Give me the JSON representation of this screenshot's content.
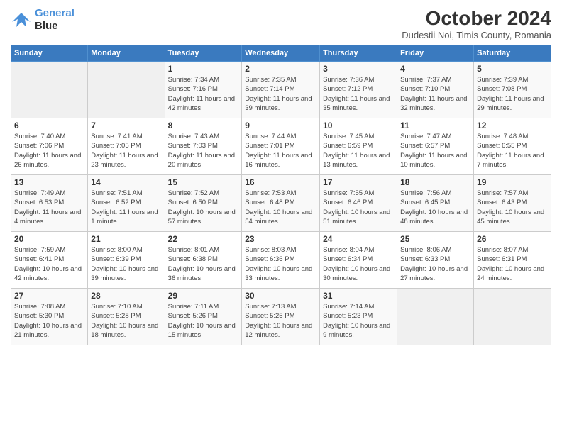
{
  "logo": {
    "line1": "General",
    "line2": "Blue"
  },
  "title": "October 2024",
  "subtitle": "Dudestii Noi, Timis County, Romania",
  "days_of_week": [
    "Sunday",
    "Monday",
    "Tuesday",
    "Wednesday",
    "Thursday",
    "Friday",
    "Saturday"
  ],
  "weeks": [
    [
      {
        "day": "",
        "info": ""
      },
      {
        "day": "",
        "info": ""
      },
      {
        "day": "1",
        "info": "Sunrise: 7:34 AM\nSunset: 7:16 PM\nDaylight: 11 hours and 42 minutes."
      },
      {
        "day": "2",
        "info": "Sunrise: 7:35 AM\nSunset: 7:14 PM\nDaylight: 11 hours and 39 minutes."
      },
      {
        "day": "3",
        "info": "Sunrise: 7:36 AM\nSunset: 7:12 PM\nDaylight: 11 hours and 35 minutes."
      },
      {
        "day": "4",
        "info": "Sunrise: 7:37 AM\nSunset: 7:10 PM\nDaylight: 11 hours and 32 minutes."
      },
      {
        "day": "5",
        "info": "Sunrise: 7:39 AM\nSunset: 7:08 PM\nDaylight: 11 hours and 29 minutes."
      }
    ],
    [
      {
        "day": "6",
        "info": "Sunrise: 7:40 AM\nSunset: 7:06 PM\nDaylight: 11 hours and 26 minutes."
      },
      {
        "day": "7",
        "info": "Sunrise: 7:41 AM\nSunset: 7:05 PM\nDaylight: 11 hours and 23 minutes."
      },
      {
        "day": "8",
        "info": "Sunrise: 7:43 AM\nSunset: 7:03 PM\nDaylight: 11 hours and 20 minutes."
      },
      {
        "day": "9",
        "info": "Sunrise: 7:44 AM\nSunset: 7:01 PM\nDaylight: 11 hours and 16 minutes."
      },
      {
        "day": "10",
        "info": "Sunrise: 7:45 AM\nSunset: 6:59 PM\nDaylight: 11 hours and 13 minutes."
      },
      {
        "day": "11",
        "info": "Sunrise: 7:47 AM\nSunset: 6:57 PM\nDaylight: 11 hours and 10 minutes."
      },
      {
        "day": "12",
        "info": "Sunrise: 7:48 AM\nSunset: 6:55 PM\nDaylight: 11 hours and 7 minutes."
      }
    ],
    [
      {
        "day": "13",
        "info": "Sunrise: 7:49 AM\nSunset: 6:53 PM\nDaylight: 11 hours and 4 minutes."
      },
      {
        "day": "14",
        "info": "Sunrise: 7:51 AM\nSunset: 6:52 PM\nDaylight: 11 hours and 1 minute."
      },
      {
        "day": "15",
        "info": "Sunrise: 7:52 AM\nSunset: 6:50 PM\nDaylight: 10 hours and 57 minutes."
      },
      {
        "day": "16",
        "info": "Sunrise: 7:53 AM\nSunset: 6:48 PM\nDaylight: 10 hours and 54 minutes."
      },
      {
        "day": "17",
        "info": "Sunrise: 7:55 AM\nSunset: 6:46 PM\nDaylight: 10 hours and 51 minutes."
      },
      {
        "day": "18",
        "info": "Sunrise: 7:56 AM\nSunset: 6:45 PM\nDaylight: 10 hours and 48 minutes."
      },
      {
        "day": "19",
        "info": "Sunrise: 7:57 AM\nSunset: 6:43 PM\nDaylight: 10 hours and 45 minutes."
      }
    ],
    [
      {
        "day": "20",
        "info": "Sunrise: 7:59 AM\nSunset: 6:41 PM\nDaylight: 10 hours and 42 minutes."
      },
      {
        "day": "21",
        "info": "Sunrise: 8:00 AM\nSunset: 6:39 PM\nDaylight: 10 hours and 39 minutes."
      },
      {
        "day": "22",
        "info": "Sunrise: 8:01 AM\nSunset: 6:38 PM\nDaylight: 10 hours and 36 minutes."
      },
      {
        "day": "23",
        "info": "Sunrise: 8:03 AM\nSunset: 6:36 PM\nDaylight: 10 hours and 33 minutes."
      },
      {
        "day": "24",
        "info": "Sunrise: 8:04 AM\nSunset: 6:34 PM\nDaylight: 10 hours and 30 minutes."
      },
      {
        "day": "25",
        "info": "Sunrise: 8:06 AM\nSunset: 6:33 PM\nDaylight: 10 hours and 27 minutes."
      },
      {
        "day": "26",
        "info": "Sunrise: 8:07 AM\nSunset: 6:31 PM\nDaylight: 10 hours and 24 minutes."
      }
    ],
    [
      {
        "day": "27",
        "info": "Sunrise: 7:08 AM\nSunset: 5:30 PM\nDaylight: 10 hours and 21 minutes."
      },
      {
        "day": "28",
        "info": "Sunrise: 7:10 AM\nSunset: 5:28 PM\nDaylight: 10 hours and 18 minutes."
      },
      {
        "day": "29",
        "info": "Sunrise: 7:11 AM\nSunset: 5:26 PM\nDaylight: 10 hours and 15 minutes."
      },
      {
        "day": "30",
        "info": "Sunrise: 7:13 AM\nSunset: 5:25 PM\nDaylight: 10 hours and 12 minutes."
      },
      {
        "day": "31",
        "info": "Sunrise: 7:14 AM\nSunset: 5:23 PM\nDaylight: 10 hours and 9 minutes."
      },
      {
        "day": "",
        "info": ""
      },
      {
        "day": "",
        "info": ""
      }
    ]
  ]
}
